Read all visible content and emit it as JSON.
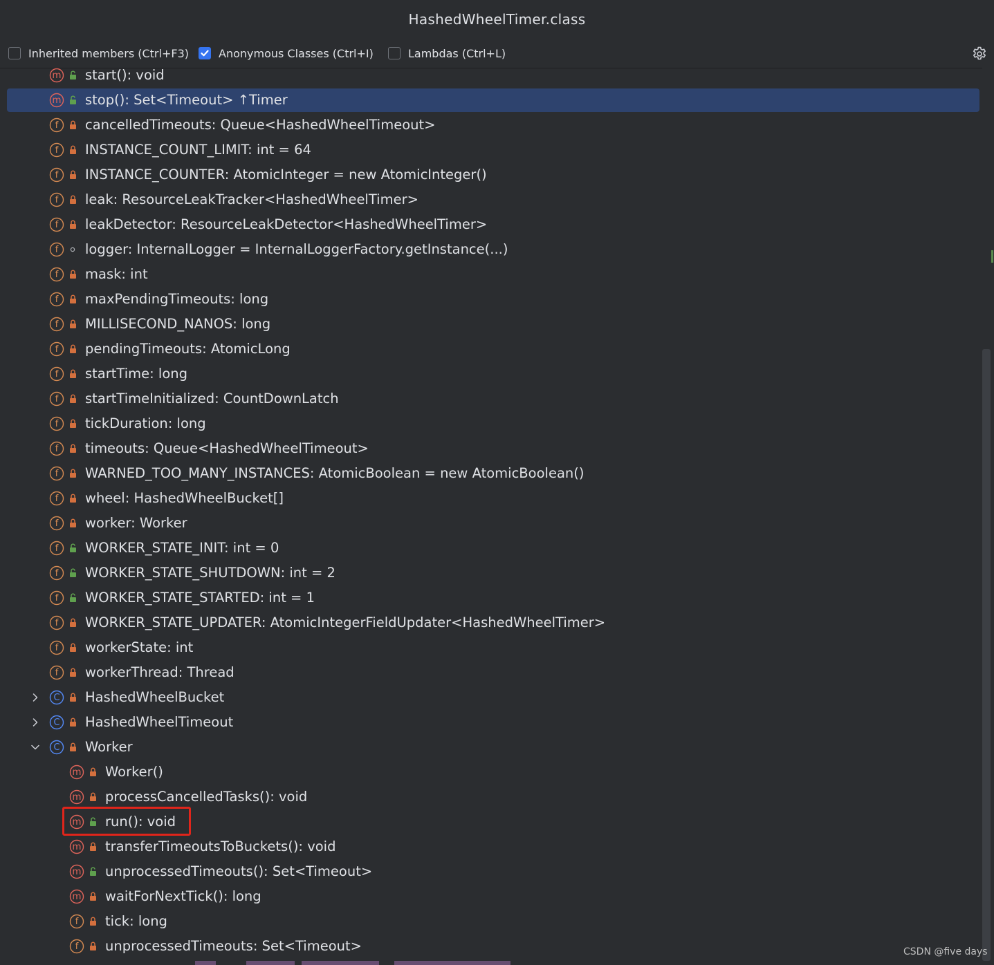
{
  "window": {
    "title": "HashedWheelTimer.class"
  },
  "options": [
    {
      "label": "Inherited members (Ctrl+F3)",
      "checked": false
    },
    {
      "label": "Anonymous Classes (Ctrl+I)",
      "checked": true
    },
    {
      "label": "Lambdas (Ctrl+L)",
      "checked": false
    }
  ],
  "settings_icon": "gear-icon",
  "colors": {
    "background": "#2b2d30",
    "selection": "#2e436e",
    "method_icon": "#e0645a",
    "field_icon": "#d58a52",
    "class_icon": "#548af7",
    "lock_private": "#d4703e",
    "lock_public": "#5fa04e",
    "highlight_box": "#e0251b"
  },
  "rows": [
    {
      "kind": "method",
      "vis": "public",
      "label": "start(): void"
    },
    {
      "kind": "method",
      "vis": "public",
      "label": "stop(): Set<Timeout> ↑Timer",
      "selected": true
    },
    {
      "kind": "field",
      "vis": "private",
      "label": "cancelledTimeouts: Queue<HashedWheelTimeout>"
    },
    {
      "kind": "field",
      "vis": "private",
      "label": "INSTANCE_COUNT_LIMIT: int = 64"
    },
    {
      "kind": "field",
      "vis": "private",
      "label": "INSTANCE_COUNTER: AtomicInteger = new AtomicInteger()"
    },
    {
      "kind": "field",
      "vis": "private",
      "label": "leak: ResourceLeakTracker<HashedWheelTimer>"
    },
    {
      "kind": "field",
      "vis": "private",
      "label": "leakDetector: ResourceLeakDetector<HashedWheelTimer>"
    },
    {
      "kind": "field",
      "vis": "package",
      "label": "logger: InternalLogger = InternalLoggerFactory.getInstance(...)"
    },
    {
      "kind": "field",
      "vis": "private",
      "label": "mask: int"
    },
    {
      "kind": "field",
      "vis": "private",
      "label": "maxPendingTimeouts: long"
    },
    {
      "kind": "field",
      "vis": "private",
      "label": "MILLISECOND_NANOS: long"
    },
    {
      "kind": "field",
      "vis": "private",
      "label": "pendingTimeouts: AtomicLong"
    },
    {
      "kind": "field",
      "vis": "private",
      "label": "startTime: long"
    },
    {
      "kind": "field",
      "vis": "private",
      "label": "startTimeInitialized: CountDownLatch"
    },
    {
      "kind": "field",
      "vis": "private",
      "label": "tickDuration: long"
    },
    {
      "kind": "field",
      "vis": "private",
      "label": "timeouts: Queue<HashedWheelTimeout>"
    },
    {
      "kind": "field",
      "vis": "private",
      "label": "WARNED_TOO_MANY_INSTANCES: AtomicBoolean = new AtomicBoolean()"
    },
    {
      "kind": "field",
      "vis": "private",
      "label": "wheel: HashedWheelBucket[]"
    },
    {
      "kind": "field",
      "vis": "private",
      "label": "worker: Worker"
    },
    {
      "kind": "field",
      "vis": "public",
      "label": "WORKER_STATE_INIT: int = 0"
    },
    {
      "kind": "field",
      "vis": "public",
      "label": "WORKER_STATE_SHUTDOWN: int = 2"
    },
    {
      "kind": "field",
      "vis": "public",
      "label": "WORKER_STATE_STARTED: int = 1"
    },
    {
      "kind": "field",
      "vis": "private",
      "label": "WORKER_STATE_UPDATER: AtomicIntegerFieldUpdater<HashedWheelTimer>"
    },
    {
      "kind": "field",
      "vis": "private",
      "label": "workerState: int"
    },
    {
      "kind": "field",
      "vis": "private",
      "label": "workerThread: Thread"
    },
    {
      "kind": "class",
      "vis": "private",
      "label": "HashedWheelBucket",
      "expander": "collapsed"
    },
    {
      "kind": "class",
      "vis": "private",
      "label": "HashedWheelTimeout",
      "expander": "collapsed"
    },
    {
      "kind": "class",
      "vis": "private",
      "label": "Worker",
      "expander": "expanded"
    },
    {
      "kind": "method",
      "vis": "private",
      "label": "Worker()",
      "depth": 1
    },
    {
      "kind": "method",
      "vis": "private",
      "label": "processCancelledTasks(): void",
      "depth": 1
    },
    {
      "kind": "method",
      "vis": "public",
      "label": "run(): void",
      "depth": 1,
      "highlighted": true
    },
    {
      "kind": "method",
      "vis": "private",
      "label": "transferTimeoutsToBuckets(): void",
      "depth": 1
    },
    {
      "kind": "method",
      "vis": "public",
      "label": "unprocessedTimeouts(): Set<Timeout>",
      "depth": 1
    },
    {
      "kind": "method",
      "vis": "private",
      "label": "waitForNextTick(): long",
      "depth": 1
    },
    {
      "kind": "field",
      "vis": "private",
      "label": "tick: long",
      "depth": 1
    },
    {
      "kind": "field",
      "vis": "private",
      "label": "unprocessedTimeouts: Set<Timeout>",
      "depth": 1
    }
  ],
  "watermark": "CSDN @five days"
}
